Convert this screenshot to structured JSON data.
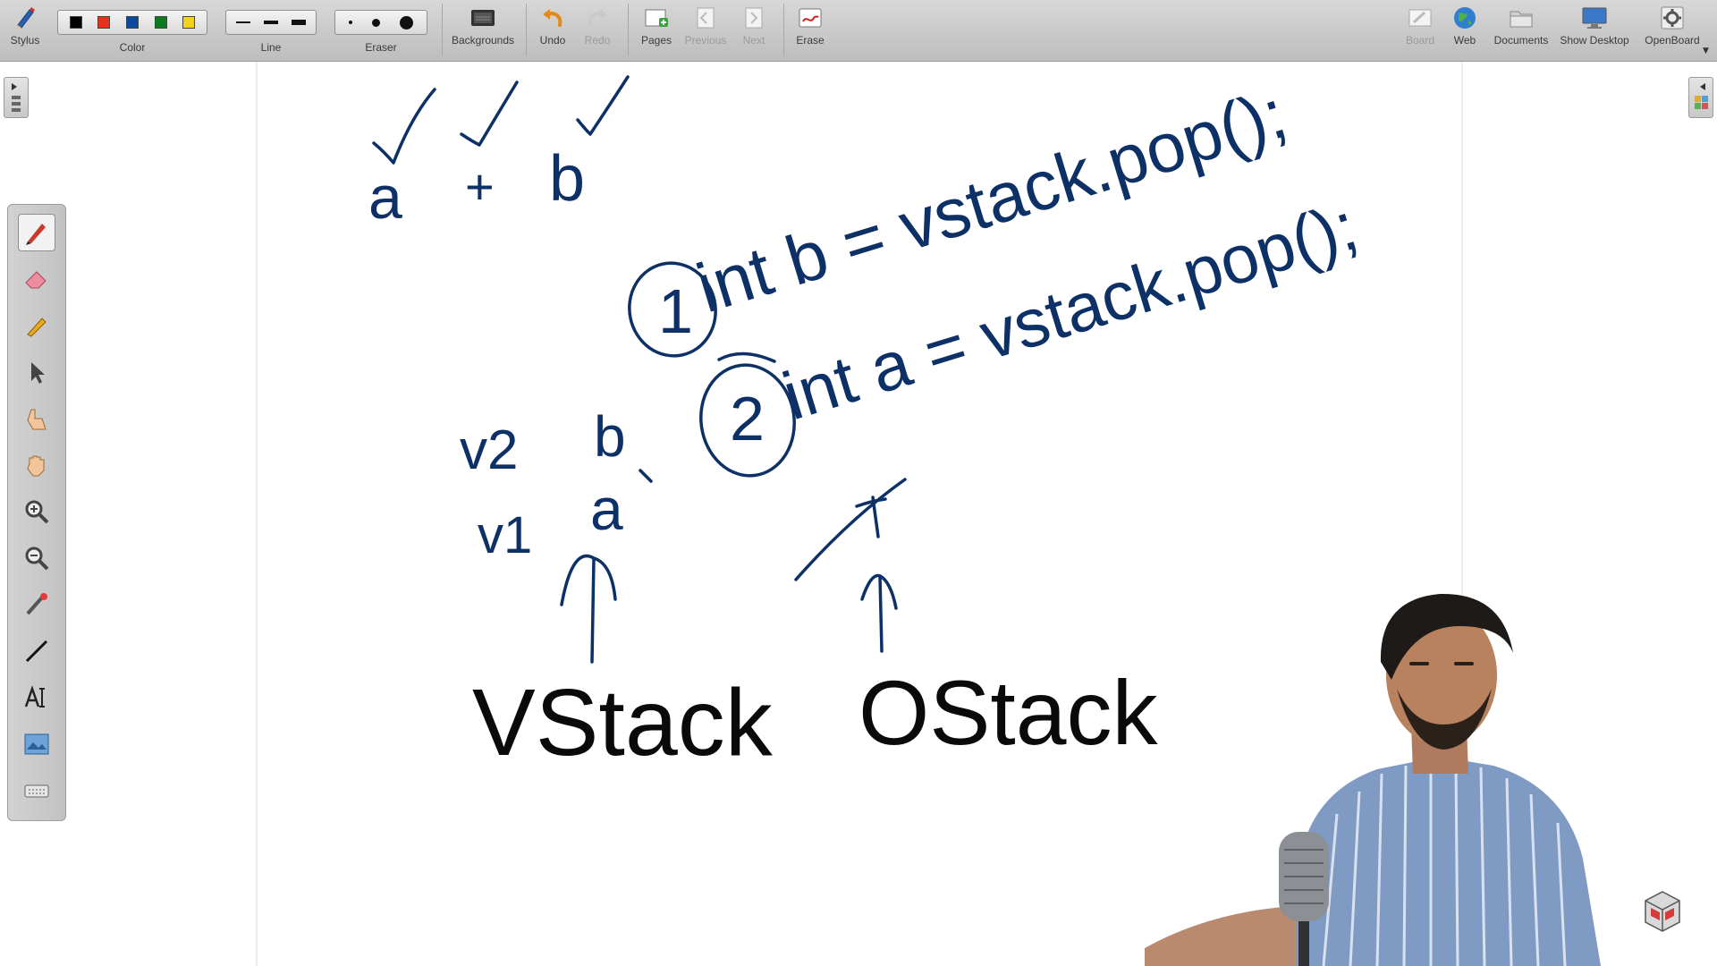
{
  "toolbar": {
    "stylus": "Stylus",
    "color": "Color",
    "line": "Line",
    "eraser": "Eraser",
    "backgrounds": "Backgrounds",
    "undo": "Undo",
    "redo": "Redo",
    "pages": "Pages",
    "previous": "Previous",
    "next": "Next",
    "erase": "Erase",
    "board": "Board",
    "web": "Web",
    "documents": "Documents",
    "show_desktop": "Show Desktop",
    "openboard": "OpenBoard"
  },
  "colors": {
    "swatches": [
      "#000000",
      "#e8311a",
      "#0a4a9e",
      "#0d7a20",
      "#f2d21c"
    ],
    "ink": "#0d3166",
    "ink_dark": "#0a0a0a"
  },
  "palette_tools": [
    "pen-icon",
    "eraser-icon",
    "marker-icon",
    "selector-icon",
    "interactor-icon",
    "hand-icon",
    "zoom-in-icon",
    "zoom-out-icon",
    "laser-pointer-icon",
    "line-icon",
    "text-icon",
    "capture-icon",
    "virtual-keyboard-icon"
  ],
  "whiteboard": {
    "top_chars": [
      "a",
      "+",
      "b"
    ],
    "line1_label": "1",
    "line1_code": "int b = vstack.pop();",
    "line2_label": "2",
    "line2_code": "int a = vstack.pop();",
    "v2_label": "v2",
    "v2_value": "b",
    "v1_label": "v1",
    "v1_value": "a",
    "vstack_label": "VStack",
    "ostack_label": "OStack"
  }
}
